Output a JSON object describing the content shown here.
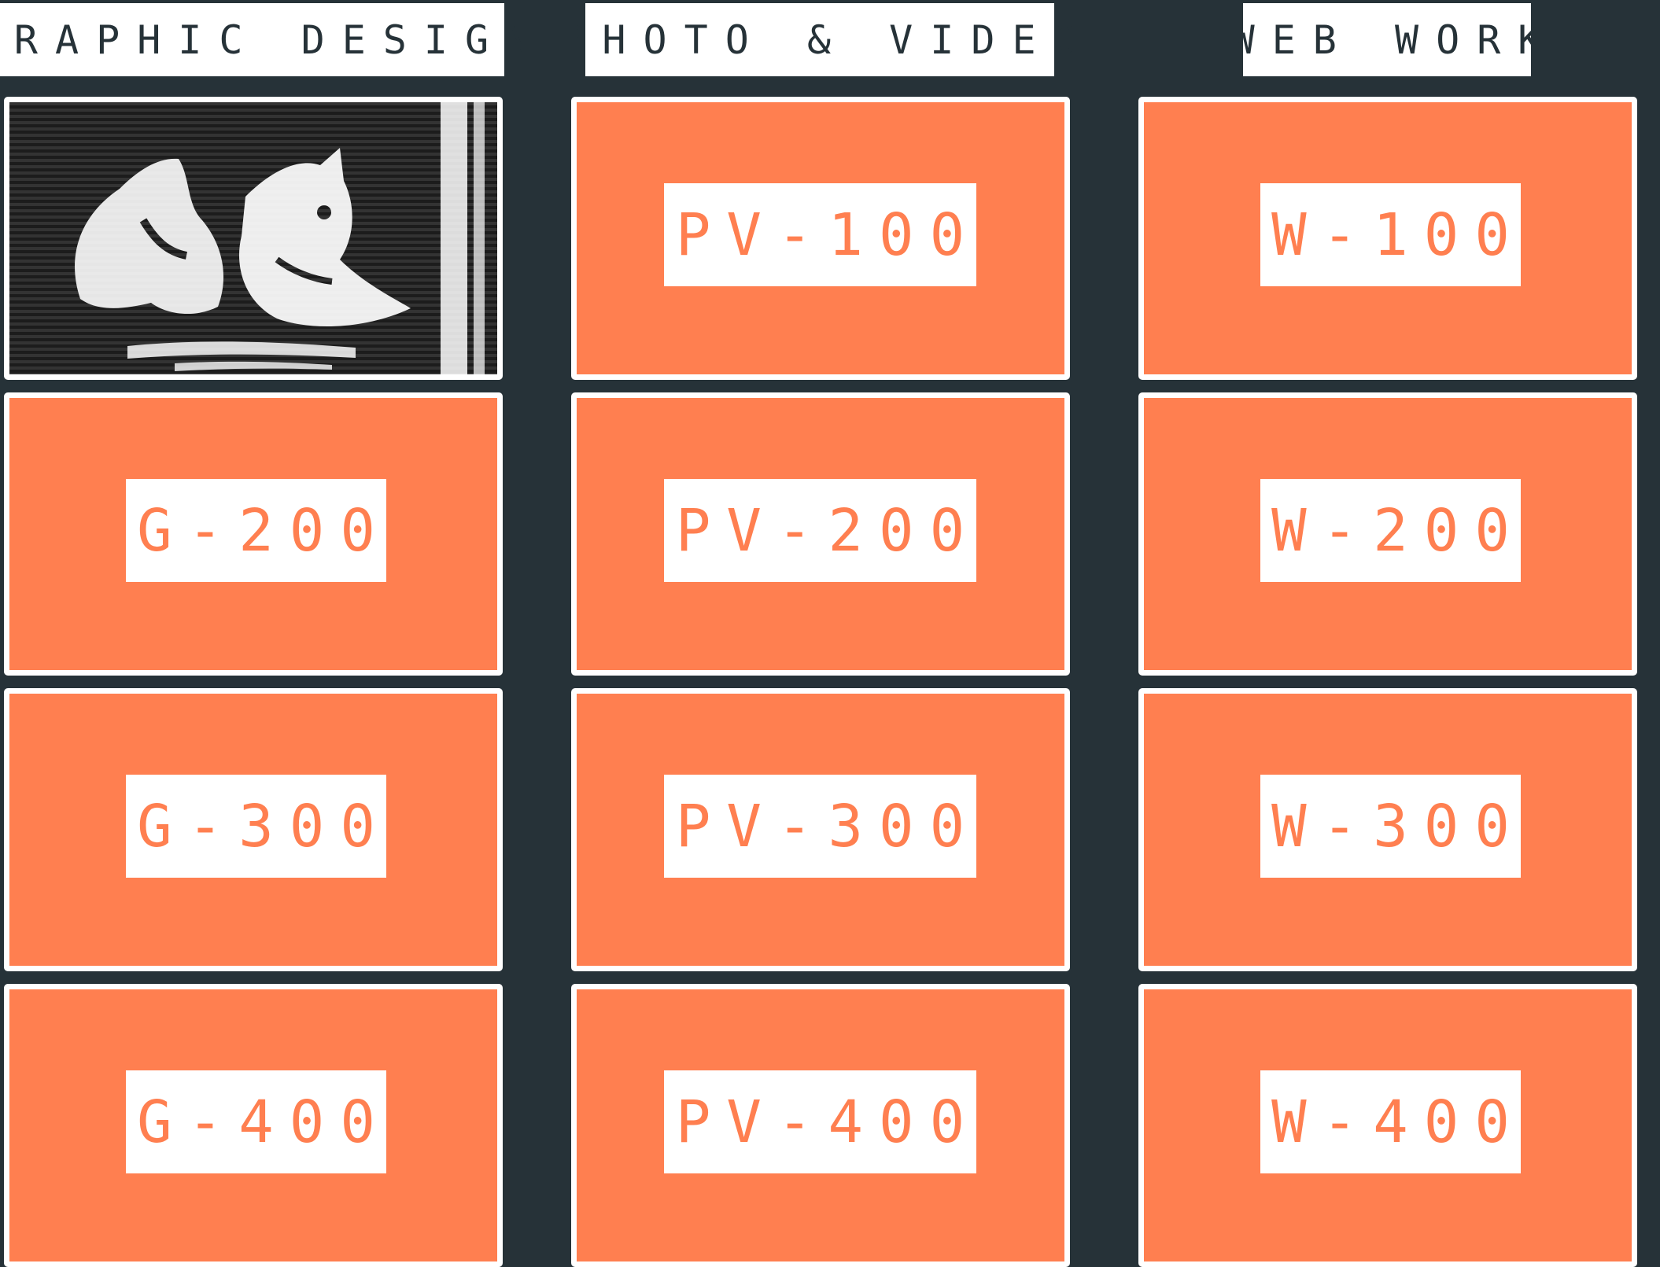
{
  "headers": {
    "graphic": "GRAPHIC DESIGN",
    "photo": "PHOTO & VIDEO",
    "web": "WEB WORK"
  },
  "colors": {
    "background": "#263238",
    "card_fill": "#ff7f50",
    "card_border": "#ffffff",
    "label_bg": "#ffffff",
    "label_text": "#ff7f50"
  },
  "graphic_design": {
    "thumbnail_icon": "cat-photo-thumbnail",
    "items": [
      "G-200",
      "G-300",
      "G-400"
    ]
  },
  "photo_video": {
    "items": [
      "PV-100",
      "PV-200",
      "PV-300",
      "PV-400"
    ]
  },
  "web_work": {
    "items": [
      "W-100",
      "W-200",
      "W-300",
      "W-400"
    ]
  }
}
